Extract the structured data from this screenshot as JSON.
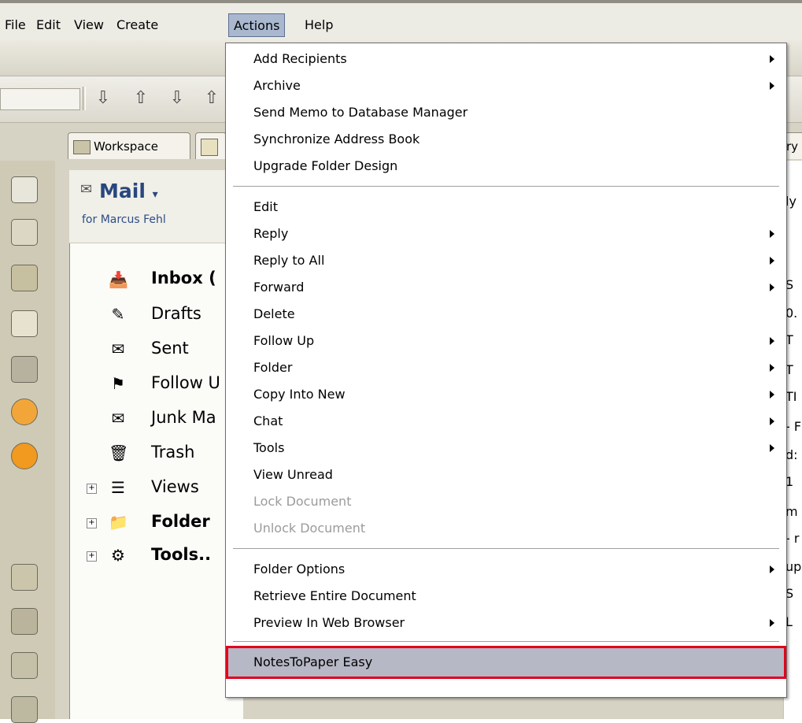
{
  "menubar": {
    "items": [
      "File",
      "Edit",
      "View",
      "Create",
      "Actions",
      "Help"
    ]
  },
  "tabs": {
    "workspace": "Workspace",
    "partial_right": "ry"
  },
  "mail": {
    "title": "Mail",
    "owner": "for Marcus Fehl"
  },
  "folders": [
    {
      "label": "Inbox (",
      "bold": true
    },
    {
      "label": "Drafts"
    },
    {
      "label": "Sent"
    },
    {
      "label": "Follow U"
    },
    {
      "label": "Junk Ma"
    },
    {
      "label": "Trash"
    },
    {
      "label": "Views"
    },
    {
      "label": "Folder",
      "bold": true
    },
    {
      "label": "Tools..",
      "bold": true
    }
  ],
  "rightpanel": {
    "fragments": [
      "ly",
      "S",
      "0.",
      "T",
      "T",
      "TI",
      "- F",
      "d:",
      "1",
      "m",
      "- r",
      "up",
      "S",
      "L"
    ]
  },
  "actions_menu": {
    "items": [
      {
        "label": "Add Recipients",
        "submenu": true
      },
      {
        "label": "Archive",
        "submenu": true
      },
      {
        "label": "Send Memo to Database Manager"
      },
      {
        "label": "Synchronize Address Book"
      },
      {
        "label": "Upgrade Folder Design"
      },
      {
        "label": "Edit"
      },
      {
        "label": "Reply",
        "submenu": true
      },
      {
        "label": "Reply to All",
        "submenu": true
      },
      {
        "label": "Forward",
        "submenu": true
      },
      {
        "label": "Delete"
      },
      {
        "label": "Follow Up",
        "submenu": true
      },
      {
        "label": "Folder",
        "submenu": true
      },
      {
        "label": "Copy Into New",
        "submenu": true
      },
      {
        "label": "Chat",
        "submenu": true
      },
      {
        "label": "Tools",
        "submenu": true
      },
      {
        "label": "View Unread"
      },
      {
        "label": "Lock Document",
        "disabled": true
      },
      {
        "label": "Unlock Document",
        "disabled": true
      },
      {
        "label": "Folder Options",
        "submenu": true
      },
      {
        "label": "Retrieve Entire Document"
      },
      {
        "label": "Preview In Web Browser",
        "submenu": true
      },
      {
        "label": "NotesToPaper Easy",
        "highlighted": true
      }
    ]
  },
  "colors": {
    "highlight_border": "#e3001b",
    "menu_active": "#a9b8cf",
    "mail_title": "#29477e"
  }
}
